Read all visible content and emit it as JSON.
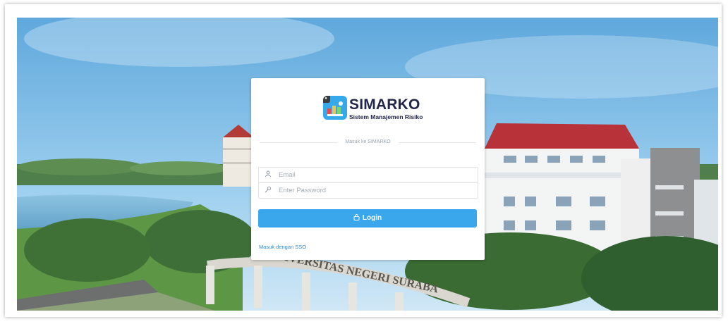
{
  "app": {
    "title": "SIMARKO",
    "subtitle": "Sistem Manajemen Risiko"
  },
  "login_form": {
    "heading": "Masuk ke SIMARKO",
    "email_placeholder": "Email",
    "password_placeholder": "Enter Password",
    "login_label": "Login",
    "sso_link": "Masuk dengan SSO"
  },
  "background": {
    "gate_text": "UNIVERSITAS NEGERI SURABA"
  },
  "colors": {
    "accent": "#3aa6ec",
    "title_dark": "#22264b",
    "link": "#3a87c6"
  }
}
